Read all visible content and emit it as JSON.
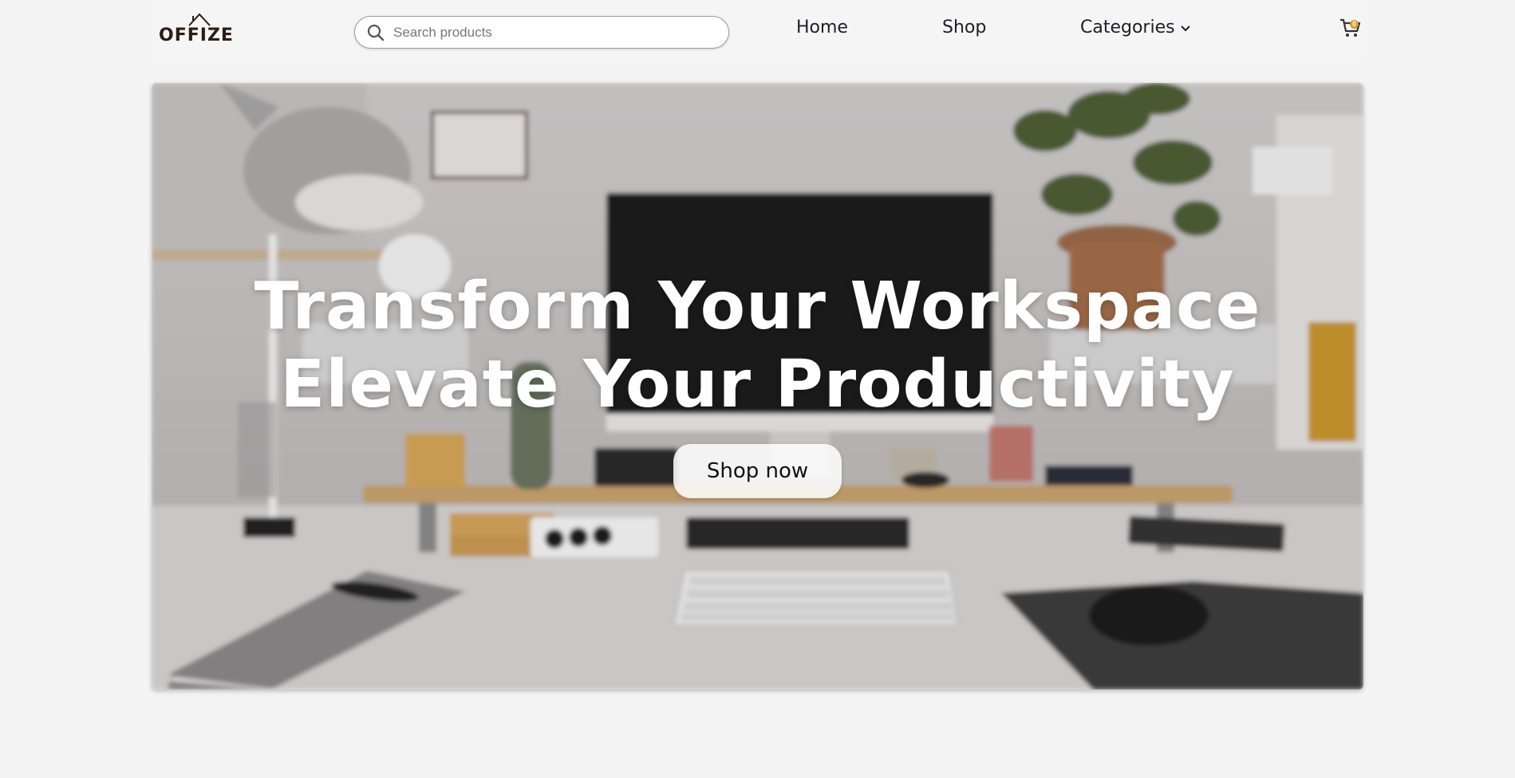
{
  "brand": {
    "name": "OFFIZE"
  },
  "search": {
    "placeholder": "Search products",
    "value": ""
  },
  "nav": {
    "home": "Home",
    "shop": "Shop",
    "categories": "Categories"
  },
  "cart": {
    "count": "0",
    "icon": "cart-icon"
  },
  "hero": {
    "title_line1": "Transform Your Workspace",
    "title_line2": "Elevate Your Productivity",
    "cta_label": "Shop now"
  },
  "colors": {
    "page_bg": "#f4f4f4",
    "logo_text": "#2b1d12",
    "cart_badge": "#d89a2a",
    "hero_text": "#ffffff"
  }
}
